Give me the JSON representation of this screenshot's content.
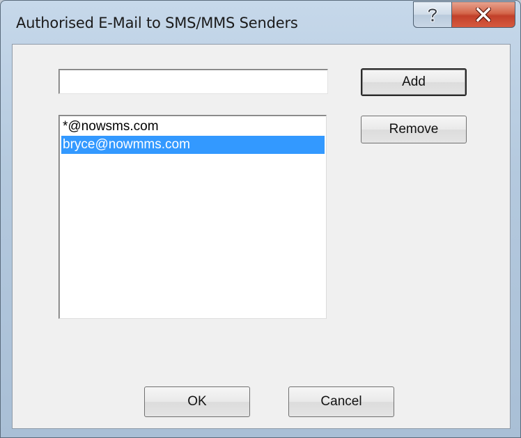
{
  "window": {
    "title": "Authorised E-Mail to SMS/MMS Senders",
    "help_icon": "question-mark",
    "close_icon": "x-close",
    "close_button_color": "#c9462f"
  },
  "form": {
    "sender_input_value": "",
    "add_label": "Add",
    "remove_label": "Remove",
    "ok_label": "OK",
    "cancel_label": "Cancel"
  },
  "senders": {
    "items": [
      {
        "label": "*@nowsms.com",
        "selected": false
      },
      {
        "label": "bryce@nowmms.com",
        "selected": true
      }
    ],
    "selection_color": "#3399ff"
  }
}
